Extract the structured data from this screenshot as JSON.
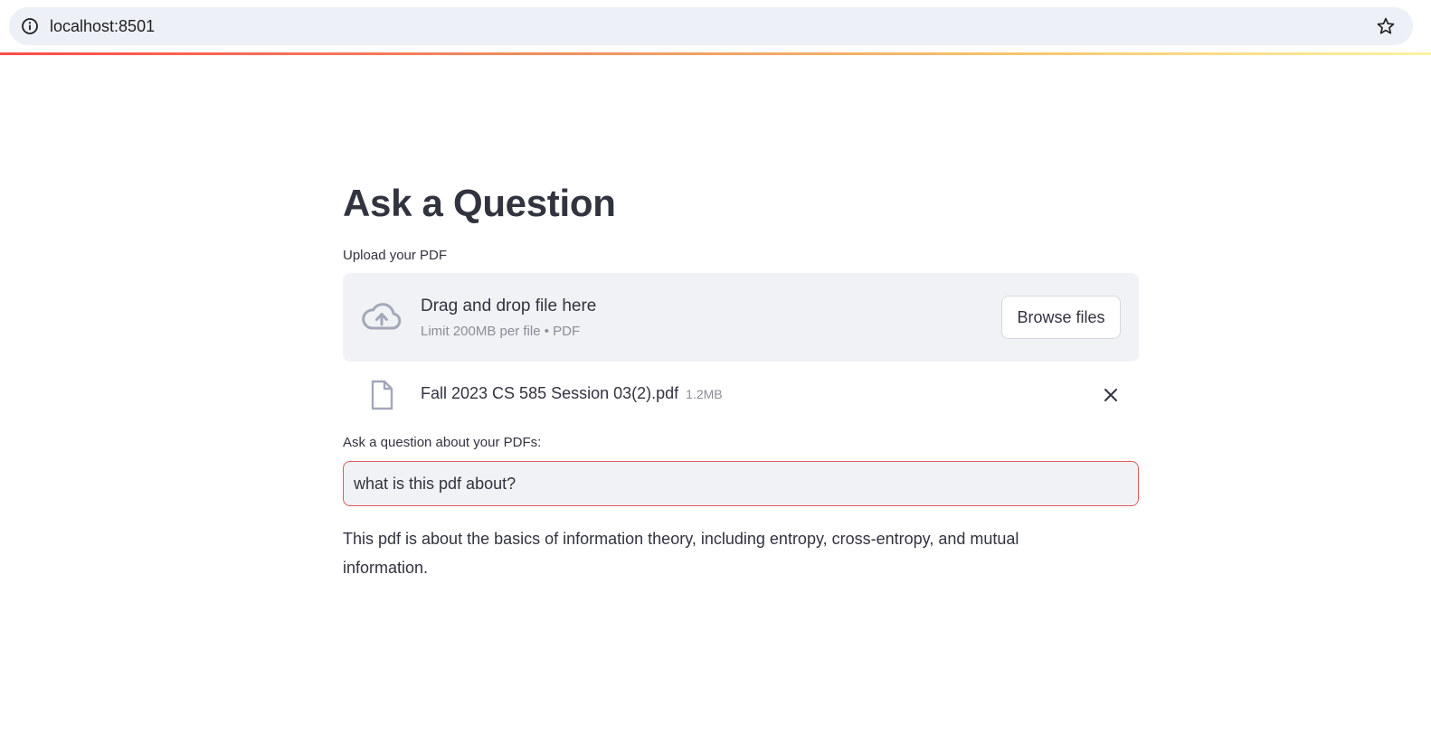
{
  "browser": {
    "url": "localhost:8501",
    "site_info_icon": "info-circle-icon",
    "bookmark_icon": "star-outline-icon"
  },
  "colors": {
    "accent": "#ff4b4b",
    "input_border": "#e05a5a",
    "dropzone_bg": "#f0f2f6",
    "text": "#31333f",
    "muted_text": "#8a8d96"
  },
  "page": {
    "title": "Ask a Question"
  },
  "uploader": {
    "label": "Upload your PDF",
    "drop_text": "Drag and drop file here",
    "limit_text": "Limit 200MB per file • PDF",
    "browse_label": "Browse files",
    "icon": "cloud-upload-icon"
  },
  "uploaded_file": {
    "name": "Fall 2023 CS 585 Session 03(2).pdf",
    "size": "1.2MB",
    "icon": "file-icon",
    "remove_icon": "close-icon"
  },
  "question": {
    "label": "Ask a question about your PDFs:",
    "value": "what is this pdf about?"
  },
  "answer": {
    "text": "This pdf is about the basics of information theory, including entropy, cross-entropy, and mutual information."
  }
}
